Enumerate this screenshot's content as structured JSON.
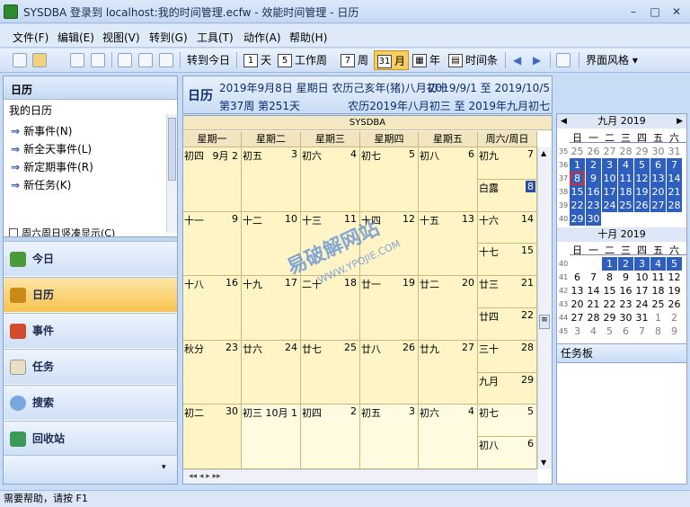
{
  "window": {
    "title": "SYSDBA 登录到 localhost:我的时间管理.ecfw - 效能时间管理 - 日历",
    "min": "–",
    "max": "□",
    "close": "✕"
  },
  "menu": [
    "文件(F)",
    "编辑(E)",
    "视图(V)",
    "转到(G)",
    "工具(T)",
    "动作(A)",
    "帮助(H)"
  ],
  "toolbar": {
    "goto_today": "转到今日",
    "day": "天",
    "day_num": "1",
    "workweek": "工作周",
    "workweek_num": "5",
    "week": "周",
    "week_num": "7",
    "month": "月",
    "month_num": "31",
    "year": "年",
    "timeline": "时间条",
    "style": "界面风格 ▾"
  },
  "nav": {
    "header": "日历",
    "my_calendar": "我的日历",
    "tasks": [
      "新事件(N)",
      "新全天事件(L)",
      "新定期事件(R)",
      "新任务(K)"
    ],
    "weekend_option": "周六周日竖凑显示(C)",
    "buttons": [
      "今日",
      "日历",
      "事件",
      "任务",
      "搜索",
      "回收站"
    ]
  },
  "header": {
    "title": "日历",
    "date": "2019年9月8日  星期日  农历己亥年(猪)八月初十",
    "week": "第37周 第251天",
    "range": "2019/9/1 至 2019/10/5",
    "lunar_range": "农历2019年八月初三 至 2019年九月初七"
  },
  "grid": {
    "owner": "SYSDBA",
    "days": [
      "星期一",
      "星期二",
      "星期三",
      "星期四",
      "星期五",
      "周六/周日"
    ],
    "weeks": [
      [
        [
          "初四",
          "9月 2"
        ],
        [
          "初五",
          "3"
        ],
        [
          "初六",
          "4"
        ],
        [
          "初七",
          "5"
        ],
        [
          "初八",
          "6"
        ],
        [
          "初九",
          "7"
        ],
        [
          "白露",
          "8"
        ]
      ],
      [
        [
          "十一",
          "9"
        ],
        [
          "十二",
          "10"
        ],
        [
          "十三",
          "11"
        ],
        [
          "十四",
          "12"
        ],
        [
          "十五",
          "13"
        ],
        [
          "十六",
          "14"
        ],
        [
          "十七",
          "15"
        ]
      ],
      [
        [
          "十八",
          "16"
        ],
        [
          "十九",
          "17"
        ],
        [
          "二十",
          "18"
        ],
        [
          "廿一",
          "19"
        ],
        [
          "廿二",
          "20"
        ],
        [
          "廿三",
          "21"
        ],
        [
          "廿四",
          "22"
        ]
      ],
      [
        [
          "秋分",
          "23"
        ],
        [
          "廿六",
          "24"
        ],
        [
          "廿七",
          "25"
        ],
        [
          "廿八",
          "26"
        ],
        [
          "廿九",
          "27"
        ],
        [
          "三十",
          "28"
        ],
        [
          "九月",
          "29"
        ]
      ],
      [
        [
          "初二",
          "30"
        ],
        [
          "初三",
          "10月 1"
        ],
        [
          "初四",
          "2"
        ],
        [
          "初五",
          "3"
        ],
        [
          "初六",
          "4"
        ],
        [
          "初七",
          "5"
        ],
        [
          "初八",
          "6"
        ]
      ]
    ],
    "nav_arrows": "◂◂  ◂  ▸  ▸▸"
  },
  "mini": {
    "sep_title": "九月 2019",
    "oct_title": "十月 2019",
    "dow": [
      "日",
      "一",
      "二",
      "三",
      "四",
      "五",
      "六"
    ],
    "sep_weeks": [
      "35",
      "36",
      "37",
      "38",
      "39",
      "40"
    ],
    "sep_rows": [
      [
        "25",
        "26",
        "27",
        "28",
        "29",
        "30",
        "31"
      ],
      [
        "1",
        "2",
        "3",
        "4",
        "5",
        "6",
        "7"
      ],
      [
        "8",
        "9",
        "10",
        "11",
        "12",
        "13",
        "14"
      ],
      [
        "15",
        "16",
        "17",
        "18",
        "19",
        "20",
        "21"
      ],
      [
        "22",
        "23",
        "24",
        "25",
        "26",
        "27",
        "28"
      ],
      [
        "29",
        "30",
        "",
        "",
        "",
        "",
        ""
      ]
    ],
    "oct_weeks": [
      "40",
      "41",
      "42",
      "43",
      "44",
      "45"
    ],
    "oct_rows": [
      [
        "",
        "",
        "1",
        "2",
        "3",
        "4",
        "5"
      ],
      [
        "6",
        "7",
        "8",
        "9",
        "10",
        "11",
        "12"
      ],
      [
        "13",
        "14",
        "15",
        "16",
        "17",
        "18",
        "19"
      ],
      [
        "20",
        "21",
        "22",
        "23",
        "24",
        "25",
        "26"
      ],
      [
        "27",
        "28",
        "29",
        "30",
        "31",
        "1",
        "2"
      ],
      [
        "3",
        "4",
        "5",
        "6",
        "7",
        "8",
        "9"
      ]
    ],
    "prev": "◀",
    "next": "▶"
  },
  "taskpad": "任务板",
  "status": "需要帮助，请按 F1",
  "watermark": "易破解网站",
  "watermark_url": "WWW.YPOJIE.COM"
}
